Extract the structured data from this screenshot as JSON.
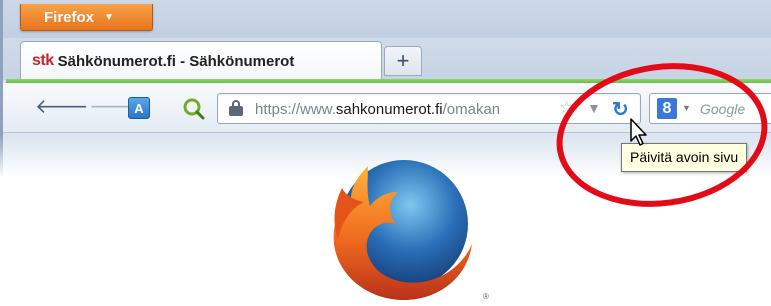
{
  "window": {
    "app_menu_label": "Firefox",
    "accent_color": "#e8741c",
    "tab_accent_color": "#6cbf4b"
  },
  "tabs": [
    {
      "favicon_text": "stk",
      "title": "Sähkönumerot.fi - Sähkönumerot"
    }
  ],
  "new_tab_label": "+",
  "navbar": {
    "url_scheme_prefix": "https://www.",
    "url_host": "sahkonumerot.fi",
    "url_path": "/omakan",
    "search_placeholder": "Google",
    "search_engine_icon": "google-icon"
  },
  "tooltip": {
    "text": "Päivitä avoin sivu"
  },
  "annotation": {
    "shape": "ellipse",
    "color": "#e30b17"
  },
  "logo": {
    "name": "firefox-logo",
    "mark": "®"
  }
}
